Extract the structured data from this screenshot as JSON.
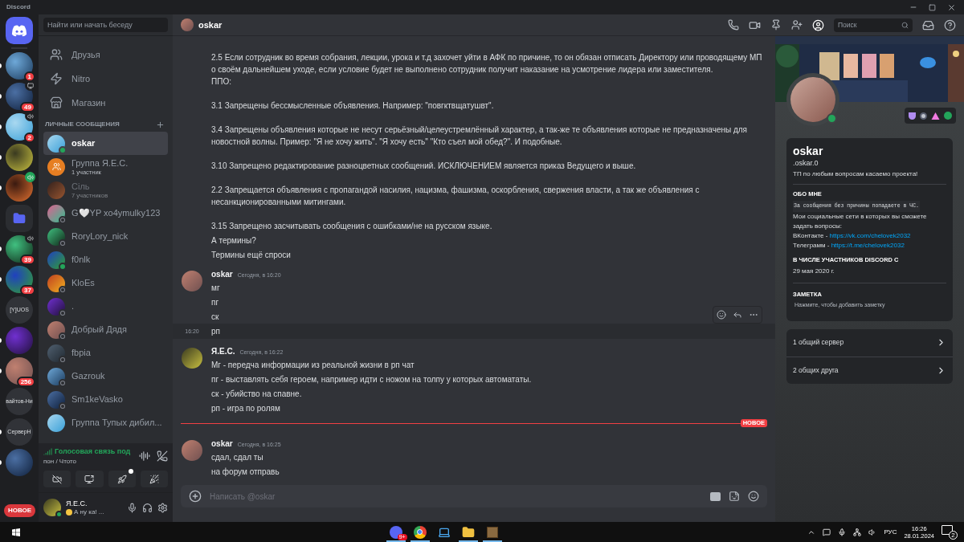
{
  "window": {
    "title": "Discord"
  },
  "servers": [
    {
      "kind": "avatar",
      "badge": "1",
      "unread": true
    },
    {
      "kind": "avatar",
      "badge": "49",
      "indicator": {
        "kind": "screen"
      },
      "unread": true
    },
    {
      "kind": "avatar",
      "badge": "2",
      "indicator": {
        "kind": "speaker"
      },
      "unread": true
    },
    {
      "kind": "avatar",
      "unread": true
    },
    {
      "kind": "avatar",
      "indicator": {
        "kind": "voice"
      },
      "unread": true
    },
    {
      "kind": "folder",
      "unread": false
    },
    {
      "kind": "avatar",
      "badge": "39",
      "indicator": {
        "kind": "speaker"
      },
      "unread": true
    },
    {
      "kind": "avatar",
      "badge": "37",
      "unread": true
    },
    {
      "kind": "text",
      "label": "[Y]UOS",
      "unread": false
    },
    {
      "kind": "avatar",
      "unread": true
    },
    {
      "kind": "avatar",
      "badge": "256",
      "unread": true
    },
    {
      "kind": "text",
      "label": "вайтов-Ни",
      "unread": false
    },
    {
      "kind": "text",
      "label": "СерверН",
      "unread": true
    },
    {
      "kind": "avatar",
      "unread": true
    }
  ],
  "new_pill": "НОВОЕ",
  "dm_search": {
    "placeholder": "Найти или начать беседу"
  },
  "nav": [
    {
      "kind": "friends",
      "label": "Друзья"
    },
    {
      "kind": "nitro",
      "label": "Nitro"
    },
    {
      "kind": "store",
      "label": "Магазин"
    }
  ],
  "dm_header": "ЛИЧНЫЕ СООБЩЕНИЯ",
  "dms": [
    {
      "name": "oskar",
      "kind": "user",
      "online": true,
      "selected": true,
      "dimmed": false
    },
    {
      "name": "Группа Я.Е.С.",
      "subtitle": "1 участник",
      "kind": "group",
      "selected": false,
      "dimmed": false
    },
    {
      "name": "Сіль",
      "subtitle": "7 участников",
      "kind": "user",
      "selected": false,
      "dimmed": true
    },
    {
      "name": "G🤍YP xo4ymulky123",
      "kind": "user",
      "online": false,
      "selected": false,
      "dimmed": false
    },
    {
      "name": "RoryLory_nick",
      "kind": "user",
      "online": false,
      "selected": false,
      "dimmed": false
    },
    {
      "name": "f0nlk",
      "kind": "user",
      "online": true,
      "selected": false,
      "dimmed": false
    },
    {
      "name": "KloEs",
      "kind": "user",
      "online": false,
      "selected": false,
      "dimmed": false
    },
    {
      "name": ".",
      "kind": "user",
      "online": false,
      "selected": false,
      "dimmed": false
    },
    {
      "name": "Добрый Дядя",
      "kind": "user",
      "online": false,
      "selected": false,
      "dimmed": false
    },
    {
      "name": "fbpia",
      "kind": "user",
      "online": false,
      "selected": false,
      "dimmed": false
    },
    {
      "name": "Gazrouk",
      "kind": "user",
      "online": false,
      "selected": false,
      "dimmed": false
    },
    {
      "name": "Sm1keVasko",
      "kind": "user",
      "online": false,
      "selected": false,
      "dimmed": false
    },
    {
      "name": "Группа Тупых дибил...",
      "kind": "user",
      "selected": false,
      "dimmed": false
    }
  ],
  "voice": {
    "title": "Голосовая связь под",
    "channel": "пон / Чтото",
    "buttons": [
      {
        "kind": "camera-off",
        "dot": false
      },
      {
        "kind": "screen",
        "dot": false
      },
      {
        "kind": "rocket",
        "dot": true
      },
      {
        "kind": "soundboard",
        "dot": false
      }
    ]
  },
  "me": {
    "name": "Я.Е.С.",
    "status_text": "А ну ка! ...",
    "online": true
  },
  "chat": {
    "title": "oskar",
    "search": {
      "placeholder": "Поиск"
    },
    "input": {
      "placeholder": "Написать @oskar"
    },
    "messages": [
      {
        "kind": "message",
        "lines": [
          {
            "text": "2.5 Если сотрудник во время собрания, лекции, урока и т.д захочет уйти в АФК по причине, то он обязан отписать Директору или проводящему МП о своём дальнейшем уходе, если условие будет не выполнено сотрудник получит наказание на усмотрение лидера или заместителя.\nППО:\n\n3.1 Запрещены бессмысленные объявления. Например: \"повгктвщатушвт\".\n\n3.4 Запрещены объявления которые не несут серьёзный/целеустремлённый характер, а так-же те объявления которые не предназначены для новостной волны. Пример: \"Я не хочу жить\". \"Я хочу есть\" \"Кто съел мой обед?\". И подобные.\n\n3.10 Запрещено редактирование разноцветных сообщений. ИСКЛЮЧЕНИЕМ является приказ Ведущего и выше.\n\n2.2 Запрещается объявления с пропагандой насилия, нацизма, фашизма, оскорбления, свержения власти, а так же объявления с несанкционированными митингами.\n\n3.15 Запрещено засчитывать сообщения с ошибками/не на русском языке.",
            "hovered": false
          },
          {
            "text": "А термины?",
            "hovered": false
          },
          {
            "text": "Термины ещё спроси",
            "hovered": false
          }
        ]
      },
      {
        "kind": "message",
        "author": "oskar",
        "time": "Сегодня, в 16:20",
        "lines": [
          {
            "text": "мг",
            "hovered": false
          },
          {
            "text": "пг",
            "hovered": false
          },
          {
            "text": "ск",
            "hovered": false
          },
          {
            "text": "рп",
            "hovered": true,
            "hover_time": "16:20"
          }
        ]
      },
      {
        "kind": "message",
        "author": "Я.Е.С.",
        "time": "Сегодня, в 16:22",
        "lines": [
          {
            "text": "Мг - передча информации из реальной жизни в рп чат",
            "hovered": false
          },
          {
            "text": "пг - выставлять себя героем, например идти с ножом на толпу у которых автомататы.",
            "hovered": false
          },
          {
            "text": "ск - убийство на спавне.",
            "hovered": false
          },
          {
            "text": "рп - игра по ролям",
            "hovered": false
          }
        ]
      },
      {
        "kind": "divider",
        "label": "НОВОЕ"
      },
      {
        "kind": "message",
        "author": "oskar",
        "time": "Сегодня, в 16:25",
        "lines": [
          {
            "text": "сдал, сдал ты",
            "hovered": false
          },
          {
            "text": "на форум отправь",
            "hovered": false
          }
        ]
      }
    ]
  },
  "profile": {
    "name": "oskar",
    "username": ".oskar.0",
    "online": true,
    "custom_status": "ТП по любым вопросам касаемо проекта!",
    "about": {
      "title": "ОБО МНЕ",
      "items": [
        {
          "kind": "code",
          "text": "За сообщения без причины попадаете в ЧС."
        },
        {
          "kind": "text",
          "text": "Мои социальные сети в которых вы сможете задать вопросы:"
        },
        {
          "kind": "link",
          "label": "ВКонтакте - ",
          "url": "https://vk.com/chelovek2032"
        },
        {
          "kind": "link",
          "label": "Телеграмм - ",
          "url": "https://t.me/chelovek2032"
        }
      ]
    },
    "member_since": {
      "title": "В ЧИСЛЕ УЧАСТНИКОВ DISCORD С",
      "value": "29 мая 2020 г."
    },
    "note": {
      "title": "ЗАМЕТКА",
      "placeholder": "Нажмите, чтобы добавить заметку"
    },
    "mutual": [
      "1 общий сервер",
      "2 общих друга"
    ]
  },
  "taskbar": {
    "apps": [
      {
        "kind": "chat",
        "running": true,
        "badge": "9+"
      },
      {
        "kind": "browser",
        "running": true
      },
      {
        "kind": "computer",
        "running": false
      },
      {
        "kind": "folder",
        "running": true
      },
      {
        "kind": "crate",
        "running": true
      }
    ],
    "language": "РУС",
    "time": "16:26",
    "date": "28.01.2024",
    "notifications": "2"
  }
}
